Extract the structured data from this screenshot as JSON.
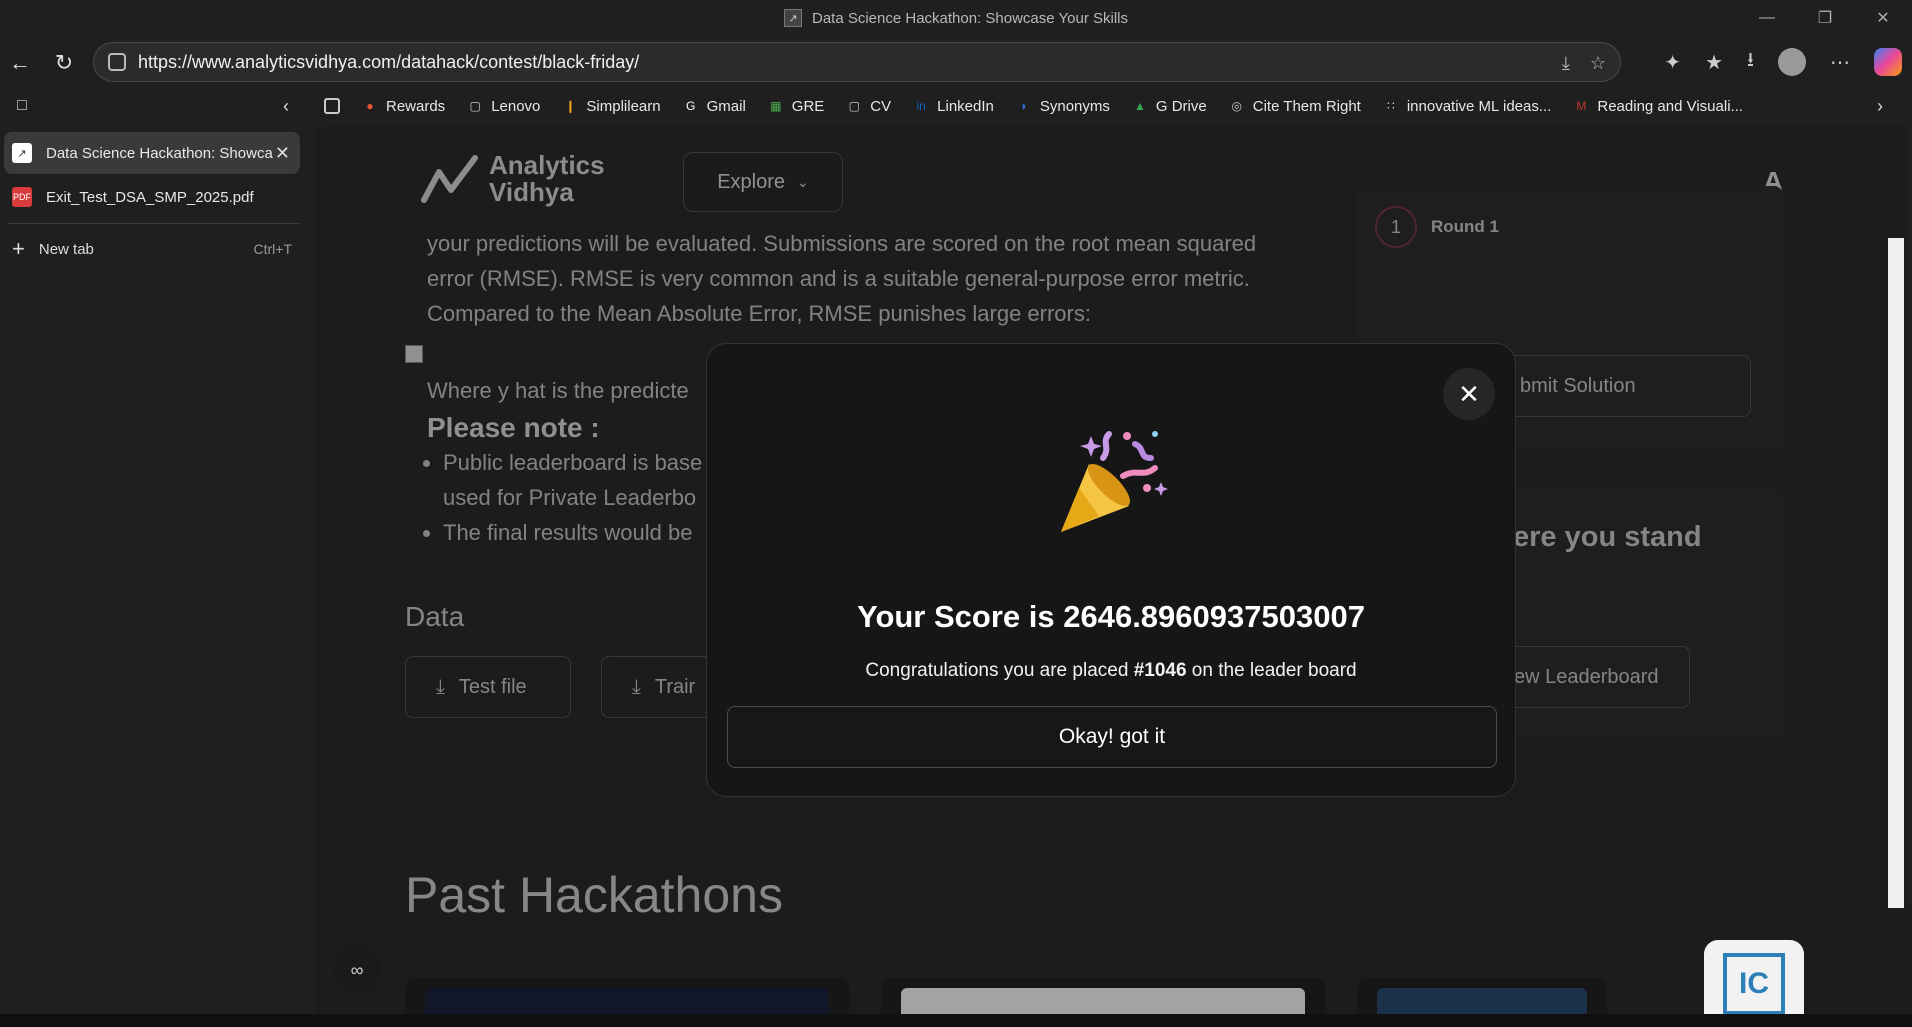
{
  "window": {
    "title": "Data Science Hackathon: Showcase Your Skills"
  },
  "address_bar": {
    "url": "https://www.analyticsvidhya.com/datahack/contest/black-friday/"
  },
  "bookmarks": [
    {
      "label": "Rewards",
      "icon": "rewards-icon",
      "color": "#e4572e"
    },
    {
      "label": "Lenovo",
      "icon": "folder-icon",
      "color": "#cccccc"
    },
    {
      "label": "Simplilearn",
      "icon": "simplilearn-icon",
      "color": "#f5a623"
    },
    {
      "label": "Gmail",
      "icon": "google-icon",
      "color": "#ffffff"
    },
    {
      "label": "GRE",
      "icon": "gre-icon",
      "color": "#4caf50"
    },
    {
      "label": "CV",
      "icon": "folder-icon",
      "color": "#cccccc"
    },
    {
      "label": "LinkedIn",
      "icon": "linkedin-icon",
      "color": "#0a66c2"
    },
    {
      "label": "Synonyms",
      "icon": "synonyms-icon",
      "color": "#2f6fe0"
    },
    {
      "label": "G Drive",
      "icon": "gdrive-icon",
      "color": "#34a853"
    },
    {
      "label": "Cite Them Right",
      "icon": "globe-icon",
      "color": "#cccccc"
    },
    {
      "label": "innovative ML ideas...",
      "icon": "grid-icon",
      "color": "#cccccc"
    },
    {
      "label": "Reading and Visuali...",
      "icon": "reading-icon",
      "color": "#c0392b"
    }
  ],
  "tabs": [
    {
      "label": "Data Science Hackathon: Showca",
      "active": true
    },
    {
      "label": "Exit_Test_DSA_SMP_2025.pdf",
      "active": false
    }
  ],
  "new_tab": {
    "label": "New tab",
    "shortcut": "Ctrl+T"
  },
  "site": {
    "logo_line1": "Analytics",
    "logo_line2": "Vidhya",
    "explore_label": "Explore",
    "user_initial": "A"
  },
  "article": {
    "para1_line1": "your predictions will be evaluated. Submissions are scored on the root mean squared",
    "para1_line2": "error (RMSE). RMSE is very common and is a suitable general-purpose error metric.",
    "para1_line3": "Compared to the Mean Absolute Error, RMSE punishes large errors:",
    "para2": "Where y hat is the predicte",
    "note_heading": "Please note :",
    "bullet1_line1": "Public leaderboard is base",
    "bullet1_line2": "used for Private Leaderbo",
    "bullet2": "The final results would be",
    "data_heading": "Data",
    "test_file_label": "Test file",
    "train_file_label": "Trair"
  },
  "right_panel": {
    "round_number": "1",
    "round_label": "Round 1",
    "submit_label": "bmit Solution",
    "stand_heading": "ere you stand",
    "leaderboard_label": "ew Leaderboard"
  },
  "past_heading": "Past Hackathons",
  "modal": {
    "score_text": "Your Score is 2646.8960937503007",
    "congrats_prefix": "Congratulations you are placed ",
    "rank": "#1046",
    "congrats_suffix": " on the leader board",
    "ok_label": "Okay! got it"
  },
  "colors": {
    "modal_bg": "#161616",
    "page_bg": "#2c2c2c",
    "ict_blue": "#2d7fb8"
  }
}
